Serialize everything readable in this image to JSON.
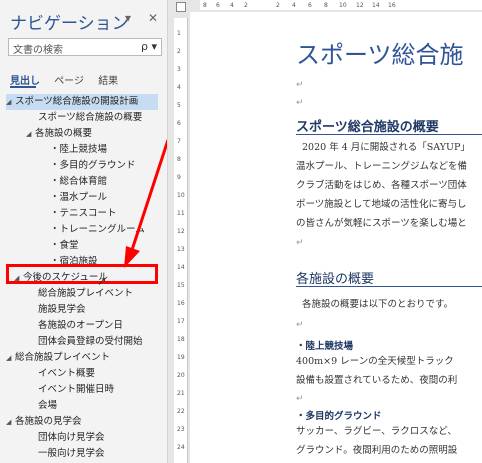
{
  "nav": {
    "title": "ナビゲーション",
    "menu_glyph": "▾",
    "close_glyph": "✕",
    "search_placeholder": "文書の検索",
    "search_glyph": "ρ ▾",
    "tabs": [
      "見出し",
      "ページ",
      "結果"
    ],
    "items": [
      {
        "label": "スポーツ総合施設の開設計画",
        "tri": "◢"
      },
      {
        "label": "スポーツ総合施設の概要",
        "tri": ""
      },
      {
        "label": "各施設の概要",
        "tri": "◢"
      },
      {
        "label": "・陸上競技場",
        "tri": ""
      },
      {
        "label": "・多目的グラウンド",
        "tri": ""
      },
      {
        "label": "・総合体育館",
        "tri": ""
      },
      {
        "label": "・温水プール",
        "tri": ""
      },
      {
        "label": "・テニスコート",
        "tri": ""
      },
      {
        "label": "・トレーニングルーム",
        "tri": ""
      },
      {
        "label": "・食堂",
        "tri": ""
      },
      {
        "label": "・宿泊施設",
        "tri": ""
      },
      {
        "label": "今後のスケジュール",
        "tri": "◢"
      },
      {
        "label": "総合施設プレイベント",
        "tri": ""
      },
      {
        "label": "施設見学会",
        "tri": ""
      },
      {
        "label": "各施設のオープン日",
        "tri": ""
      },
      {
        "label": "団体会員登録の受付開始",
        "tri": ""
      },
      {
        "label": "総合施設プレイベント",
        "tri": "◢"
      },
      {
        "label": "イベント概要",
        "tri": ""
      },
      {
        "label": "イベント開催日時",
        "tri": ""
      },
      {
        "label": "会場",
        "tri": ""
      },
      {
        "label": "各施設の見学会",
        "tri": "◢"
      },
      {
        "label": "団体向け見学会",
        "tri": ""
      },
      {
        "label": "一般向け見学会",
        "tri": ""
      }
    ]
  },
  "ruler": {
    "h_ticks": [
      "8",
      "6",
      "4",
      "2",
      "2",
      "4",
      "6",
      "8",
      "10",
      "12",
      "14",
      "16"
    ],
    "v_ticks": [
      "1",
      "2",
      "3",
      "4",
      "5",
      "6",
      "7",
      "8",
      "9",
      "10",
      "11",
      "12",
      "13",
      "14",
      "15",
      "16",
      "17",
      "18",
      "19",
      "20",
      "21",
      "22",
      "23",
      "24"
    ]
  },
  "doc": {
    "title": "スポーツ総合施",
    "para": "↵",
    "h2_overview": "スポーツ総合施設の概要",
    "overview_lines": [
      "2020 年 4 月に開設される「SAYUP」",
      "温水プール、トレーニングジムなどを備",
      "クラブ活動をはじめ、各種スポーツ団体",
      "ポーツ施設として地域の活性化に寄与し",
      "の皆さんが気軽にスポーツを楽しむ場と"
    ],
    "h2_facilities": "各施設の概要",
    "facilities_intro": "各施設の概要は以下のとおりです。",
    "sub1": "・陸上競技場",
    "sub1_lines": [
      "400m×9 レーンの全天候型トラック",
      "設備も設置されているため、夜間の利"
    ],
    "sub2": "・多目的グラウンド",
    "sub2_lines": [
      "サッカー、ラグビー、ラクロスなど、",
      "グラウンド。夜間利用のための照明設"
    ]
  },
  "colors": {
    "accent": "#2f5597",
    "annotation": "#ff0000",
    "selection": "#c6dcf2"
  }
}
